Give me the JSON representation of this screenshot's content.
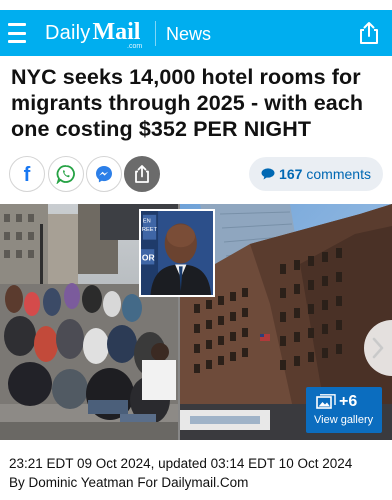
{
  "header": {
    "brand_daily": "Daily",
    "brand_mail": "Mail",
    "brand_com": ".com",
    "section": "News",
    "accent_color": "#00aeef",
    "menu_icon": "hamburger-menu-icon",
    "share_icon": "share-icon"
  },
  "article": {
    "headline": "NYC seeks 14,000 hotel rooms for migrants through 2025 - with each one costing $352 PER NIGHT",
    "dateline": "23:21 EDT 09 Oct 2024, updated 03:14 EDT 10 Oct 2024",
    "byline": "By Dominic Yeatman For Dailymail.Com"
  },
  "social": {
    "buttons": [
      "facebook-icon",
      "whatsapp-icon",
      "messenger-icon",
      "share-icon"
    ],
    "facebook_letter": "f",
    "comments_count": "167",
    "comments_label": "comments"
  },
  "media": {
    "inset_text": "EN REET",
    "gallery_count": "+6",
    "gallery_label": "View gallery",
    "next_icon": "chevron-right-icon"
  }
}
